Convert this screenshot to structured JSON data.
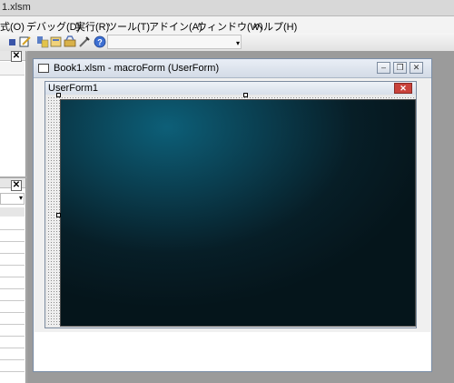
{
  "app": {
    "title": "1.xlsm"
  },
  "menu": {
    "items": [
      {
        "label": "式(O)"
      },
      {
        "label": "デバッグ(D)"
      },
      {
        "label": "実行(R)"
      },
      {
        "label": "ツール(T)"
      },
      {
        "label": "アドイン(A)"
      },
      {
        "label": "ウィンドウ(W)"
      },
      {
        "label": "ヘルプ(H)"
      }
    ]
  },
  "toolbar": {
    "icons": [
      "design-mode-icon",
      "project-explorer-icon",
      "properties-icon",
      "object-browser-icon",
      "toolbox-icon",
      "help-icon"
    ]
  },
  "code_window": {
    "title": "Book1.xlsm - macroForm (UserForm)",
    "buttons": {
      "minimize": "–",
      "restore": "❐",
      "close": "✕"
    }
  },
  "userform": {
    "title": "UserForm1",
    "close_glyph": "✕"
  },
  "panels": {
    "close_glyph": "✕",
    "dropdown_glyph": "▾"
  }
}
